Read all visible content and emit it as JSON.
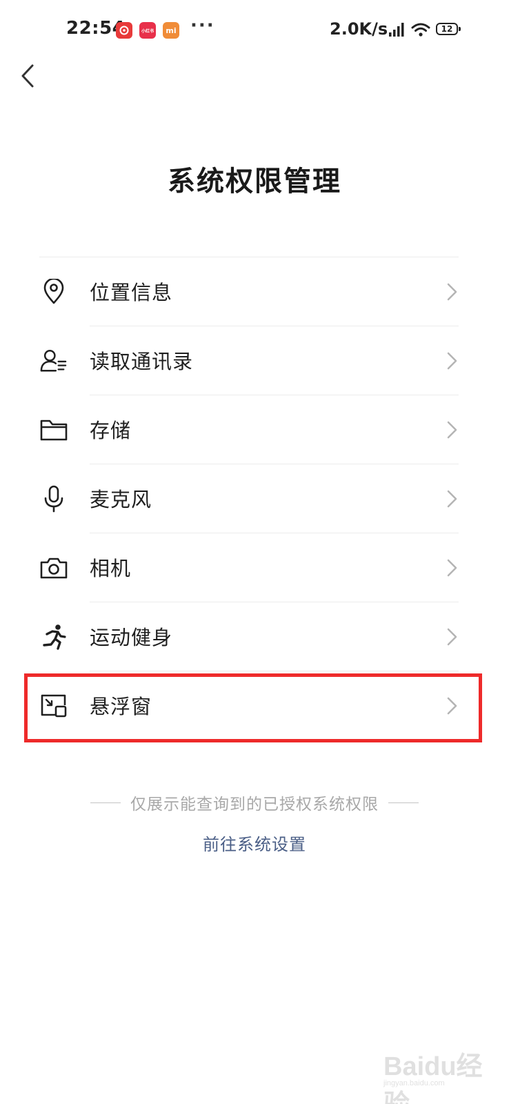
{
  "status_bar": {
    "time": "22:54",
    "app_icons": [
      {
        "name": "netease-music-icon",
        "label": "",
        "color": "#e83a3a"
      },
      {
        "name": "xiaohongshu-icon",
        "label": "小红书",
        "color": "#e8304a"
      },
      {
        "name": "mi-icon",
        "label": "mi",
        "color": "#f08c38"
      }
    ],
    "more": "···",
    "speed": "2.0K/s",
    "battery": "12"
  },
  "header": {
    "title": "系统权限管理"
  },
  "permissions": [
    {
      "label": "位置信息",
      "icon": "location-pin-icon"
    },
    {
      "label": "读取通讯录",
      "icon": "contacts-icon"
    },
    {
      "label": "存储",
      "icon": "folder-icon"
    },
    {
      "label": "麦克风",
      "icon": "microphone-icon"
    },
    {
      "label": "相机",
      "icon": "camera-icon"
    },
    {
      "label": "运动健身",
      "icon": "running-icon"
    },
    {
      "label": "悬浮窗",
      "icon": "floating-window-icon"
    }
  ],
  "highlight": {
    "color": "#ee2a2a",
    "target": "悬浮窗"
  },
  "footer": {
    "note": "仅展示能查询到的已授权系统权限",
    "link": "前往系统设置"
  },
  "watermark": {
    "brand": "Baidu经验",
    "url": "jingyan.baidu.com"
  }
}
